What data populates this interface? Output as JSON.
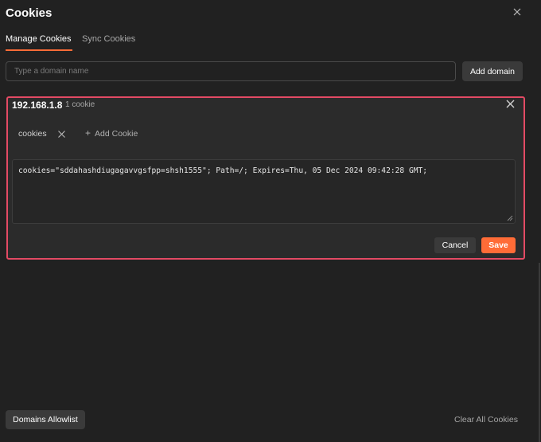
{
  "modal": {
    "title": "Cookies",
    "close_icon": "close-icon"
  },
  "tabs": [
    {
      "label": "Manage Cookies",
      "active": true
    },
    {
      "label": "Sync Cookies",
      "active": false
    }
  ],
  "domain_input": {
    "placeholder": "Type a domain name",
    "value": ""
  },
  "add_domain_label": "Add domain",
  "domain_card": {
    "domain": "192.168.1.8",
    "cookie_count": "1 cookie",
    "highlight_color": "#e34a64",
    "cookie_tabs": [
      {
        "label": "cookies"
      }
    ],
    "add_cookie_label": "Add Cookie",
    "cookie_string": "cookies=\"sddahashdiugagavvgsfpp=shsh1555\"; Path=/; Expires=Thu, 05 Dec 2024 09:42:28 GMT;",
    "cancel_label": "Cancel",
    "save_label": "Save"
  },
  "footer": {
    "allowlist_label": "Domains Allowlist",
    "clear_all_label": "Clear All Cookies"
  },
  "colors": {
    "accent": "#ff6c37",
    "background": "#212121",
    "panel": "#2b2b2b"
  }
}
